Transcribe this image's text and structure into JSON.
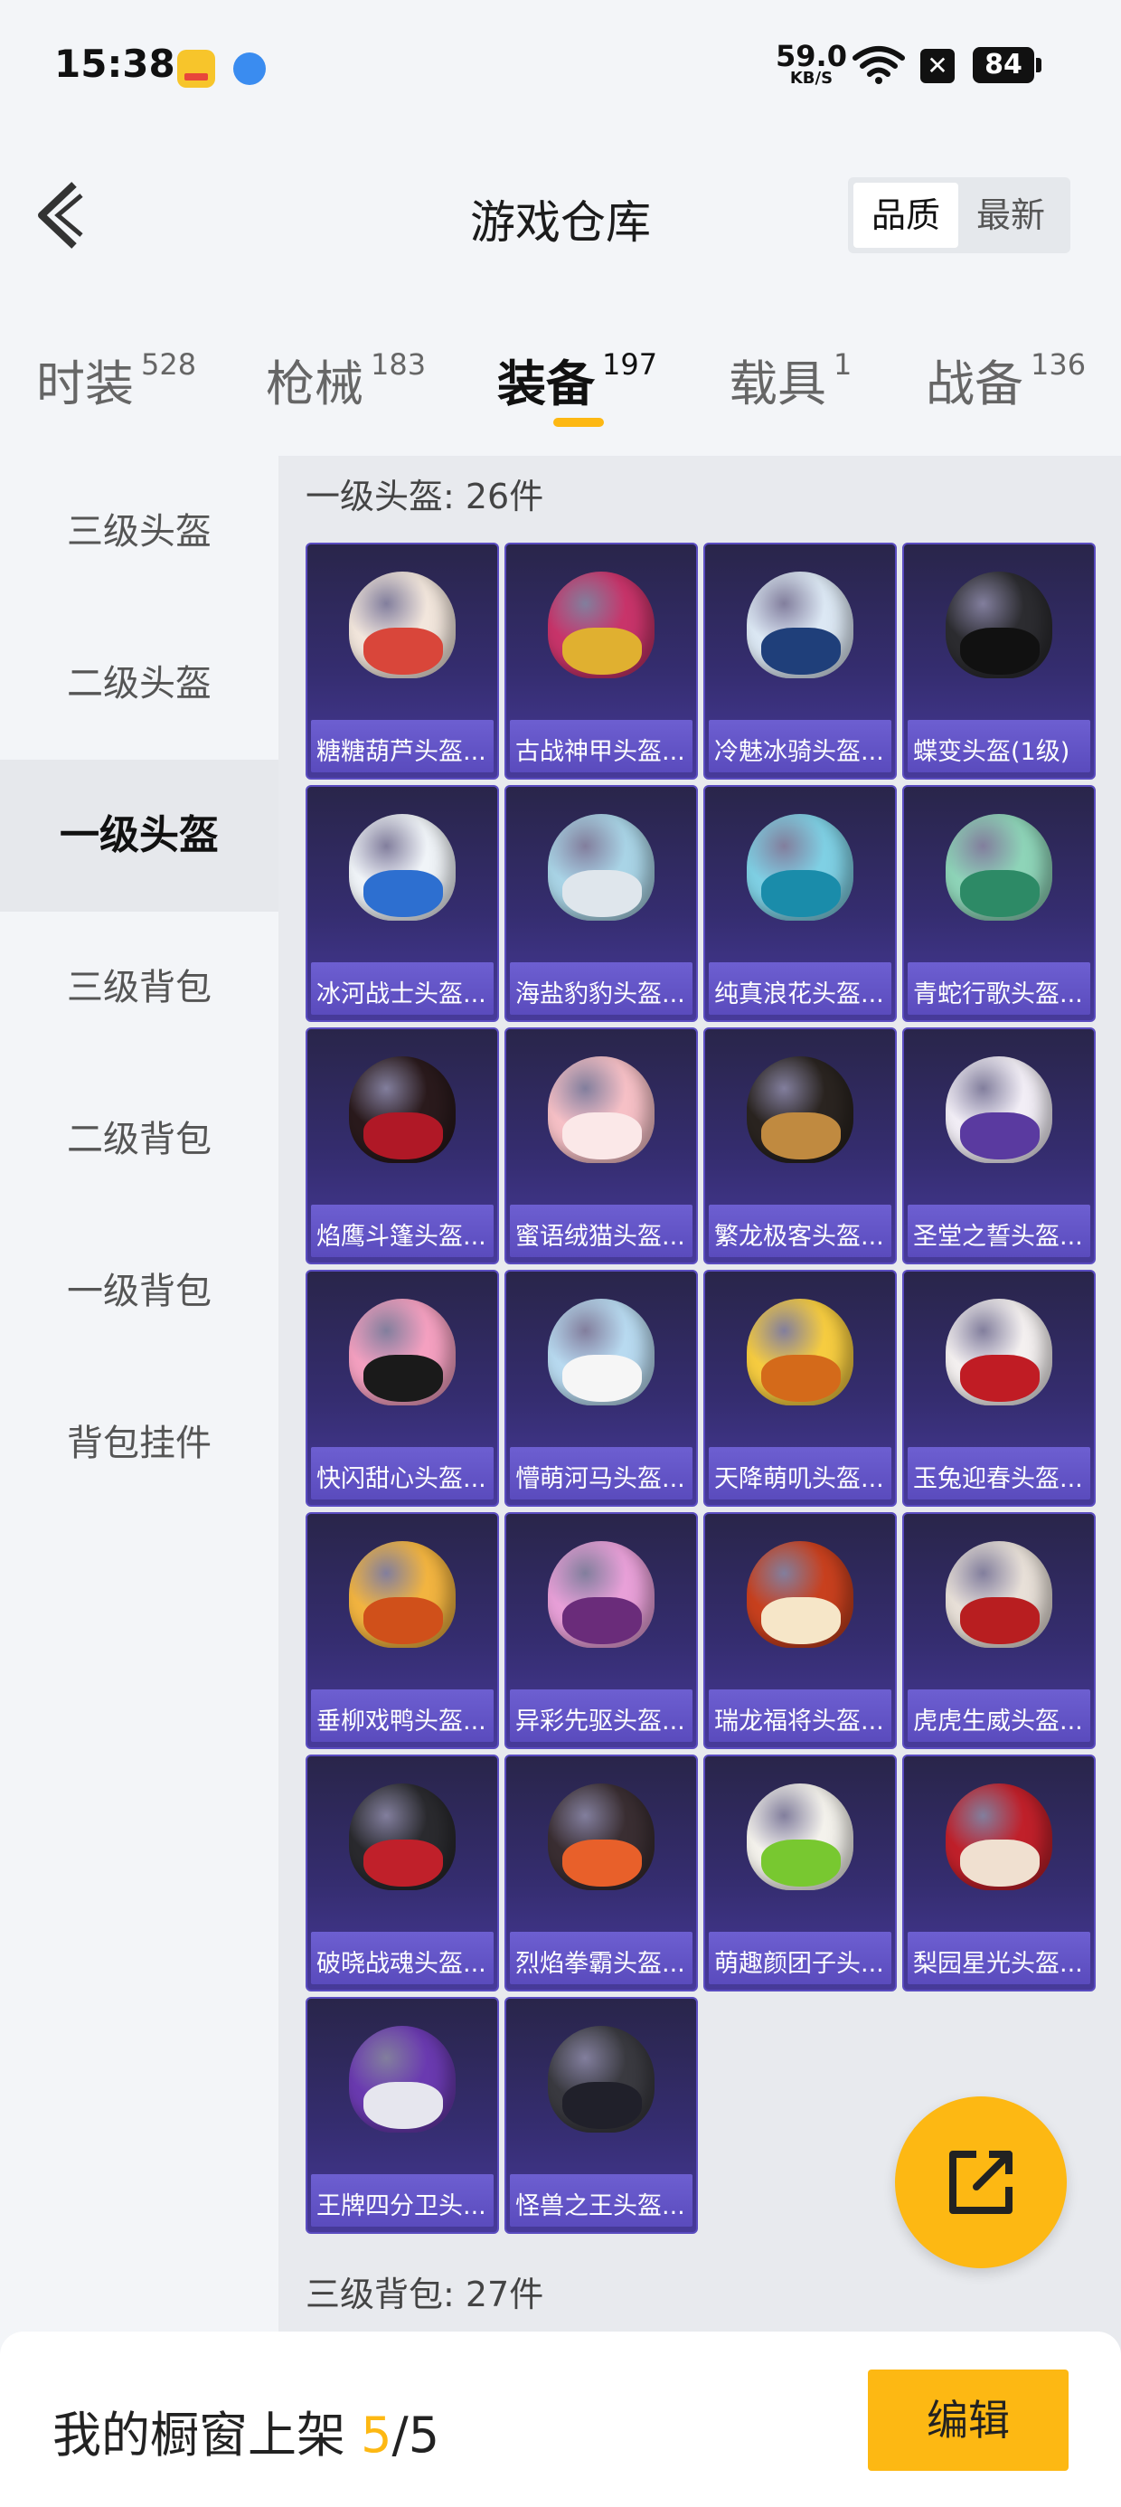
{
  "status_bar": {
    "time": "15:38",
    "net_speed": "59.0",
    "net_unit": "KB/S",
    "battery": "84",
    "icons": [
      "game-app-icon",
      "browser-app-icon",
      "wifi-icon",
      "x-notification-icon",
      "battery-icon"
    ]
  },
  "header": {
    "title": "游戏仓库",
    "sort_options": [
      "品质",
      "最新"
    ],
    "sort_selected": "品质"
  },
  "tabs": [
    {
      "label": "时装",
      "count": "528"
    },
    {
      "label": "枪械",
      "count": "183"
    },
    {
      "label": "装备",
      "count": "197"
    },
    {
      "label": "载具",
      "count": "1"
    },
    {
      "label": "战备",
      "count": "136"
    }
  ],
  "active_tab": "装备",
  "sidebar": {
    "items": [
      "三级头盔",
      "二级头盔",
      "一级头盔",
      "三级背包",
      "二级背包",
      "一级背包",
      "背包挂件"
    ],
    "active": "一级头盔"
  },
  "section": {
    "title": "一级头盔: 26件",
    "items": [
      {
        "name": "糖糖葫芦头盔...",
        "color": "#f2e6dc",
        "accent": "#d9463a"
      },
      {
        "name": "古战神甲头盔...",
        "color": "#c8346a",
        "accent": "#e0b030"
      },
      {
        "name": "冷魅冰骑头盔...",
        "color": "#dce8f4",
        "accent": "#1f3f7a"
      },
      {
        "name": "蝶变头盔(1级)",
        "color": "#2c2c30",
        "accent": "#111"
      },
      {
        "name": "冰河战士头盔...",
        "color": "#f0f4f8",
        "accent": "#2d6fd0"
      },
      {
        "name": "海盐豹豹头盔...",
        "color": "#a9d4e6",
        "accent": "#dfe6ec"
      },
      {
        "name": "纯真浪花头盔...",
        "color": "#7fd0e4",
        "accent": "#1a8caa"
      },
      {
        "name": "青蛇行歌头盔...",
        "color": "#8ed4b8",
        "accent": "#2d8a66"
      },
      {
        "name": "焰鹰斗篷头盔...",
        "color": "#2a1a1c",
        "accent": "#b01826"
      },
      {
        "name": "蜜语绒猫头盔...",
        "color": "#f6c0c6",
        "accent": "#fbe8e8"
      },
      {
        "name": "繁龙极客头盔...",
        "color": "#2a2420",
        "accent": "#c08a40"
      },
      {
        "name": "圣堂之誓头盔...",
        "color": "#f2eef6",
        "accent": "#5a3aa0"
      },
      {
        "name": "快闪甜心头盔...",
        "color": "#f4a0c0",
        "accent": "#1a1a1a"
      },
      {
        "name": "懵萌河马头盔...",
        "color": "#b8daf0",
        "accent": "#f6f6f6"
      },
      {
        "name": "天降萌叽头盔...",
        "color": "#f6cc40",
        "accent": "#d46a1a"
      },
      {
        "name": "玉兔迎春头盔...",
        "color": "#f4f0f0",
        "accent": "#c01c24"
      },
      {
        "name": "垂柳戏鸭头盔...",
        "color": "#f2b440",
        "accent": "#d0501a"
      },
      {
        "name": "异彩先驱头盔...",
        "color": "#e8a0d8",
        "accent": "#6a2c7a"
      },
      {
        "name": "瑞龙福将头盔...",
        "color": "#c8401e",
        "accent": "#f6e6c8"
      },
      {
        "name": "虎虎生威头盔...",
        "color": "#e8e0d8",
        "accent": "#b81e20"
      },
      {
        "name": "破晓战魂头盔...",
        "color": "#2a2a2e",
        "accent": "#c0202a"
      },
      {
        "name": "烈焰拳霸头盔...",
        "color": "#3a2e32",
        "accent": "#e8602a"
      },
      {
        "name": "萌趣颜团子头...",
        "color": "#f4f2ec",
        "accent": "#78c830"
      },
      {
        "name": "梨园星光头盔...",
        "color": "#c0202a",
        "accent": "#f0e0d0"
      },
      {
        "name": "王牌四分卫头...",
        "color": "#6a3ab0",
        "accent": "#e6e6ee"
      },
      {
        "name": "怪兽之王头盔...",
        "color": "#3a3a40",
        "accent": "#20202a"
      }
    ]
  },
  "next_section": {
    "title": "三级背包: 27件"
  },
  "share_button": {
    "icon": "share-external-icon"
  },
  "bottom_bar": {
    "label": "我的橱窗上架",
    "shown": "5",
    "total": "/5",
    "edit_label": "编辑"
  }
}
